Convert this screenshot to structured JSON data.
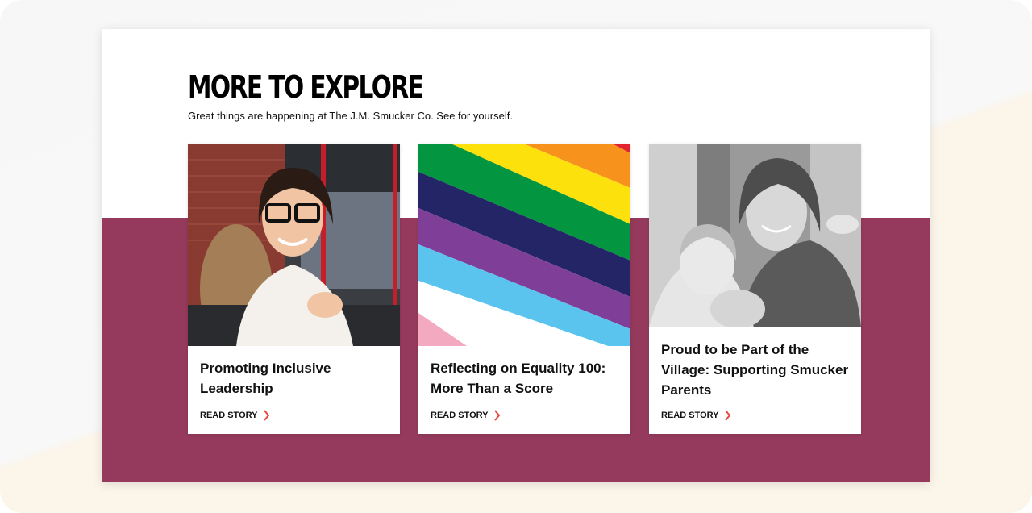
{
  "section": {
    "title": "MORE TO EXPLORE",
    "subtitle": "Great things are happening at The J.M. Smucker Co. See for yourself."
  },
  "cards": [
    {
      "title": "Promoting Inclusive Leadership",
      "link": "READ STORY",
      "image": "woman-with-glasses-smiling-photo"
    },
    {
      "title": "Reflecting on Equality 100: More Than a Score",
      "link": "READ STORY",
      "image": "pride-rainbow-stripes"
    },
    {
      "title": "Proud to be Part of the Village: Supporting Smucker Parents",
      "link": "READ STORY",
      "image": "mother-with-children-bw-photo"
    }
  ],
  "colors": {
    "band": "#953a5c",
    "accent_chevron": "#e8473f"
  }
}
